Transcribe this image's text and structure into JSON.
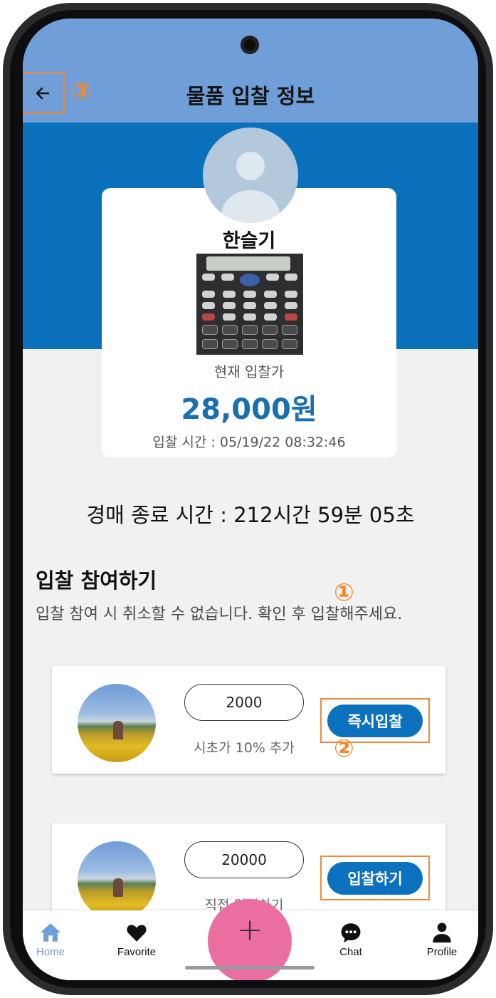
{
  "header": {
    "title": "물품 입찰 정보",
    "back_icon": "arrow-left-icon",
    "annotation_back": "③"
  },
  "seller": {
    "name": "한슬기",
    "avatar_icon": "default-person-avatar"
  },
  "product": {
    "image": "calculator-photo",
    "current_bid_label": "현재 입찰가",
    "current_bid_price": "28,000원",
    "bid_time": "입찰 시간 : 05/19/22 08:32:46"
  },
  "auction": {
    "end_time_text": "경매 종료 시간 : 212시간 59분 05초"
  },
  "participate": {
    "title": "입찰 참여하기",
    "description": "입찰 참여 시 취소할 수 없습니다. 확인 후 입찰해주세요."
  },
  "bid_options": [
    {
      "annotation": "①",
      "amount": "2000",
      "note": "시초가 10% 추가",
      "button_label": "즉시입찰"
    },
    {
      "annotation": "②",
      "amount": "20000",
      "note": "직접 입력하기",
      "button_label": "입찰하기"
    }
  ],
  "bottom_nav": {
    "items": [
      {
        "label": "Home",
        "icon": "home-icon",
        "active": true
      },
      {
        "label": "Favorite",
        "icon": "heart-icon"
      },
      {
        "label": "Chat",
        "icon": "chat-bubble-icon"
      },
      {
        "label": "Profile",
        "icon": "person-icon"
      }
    ],
    "fab_symbol": "+"
  },
  "colors": {
    "appbar": "#6f9ed8",
    "band": "#0a70bc",
    "primary_button": "#0d72bd",
    "price": "#1a6fae",
    "annotation": "#f08c2d",
    "fab": "#ea6fa0"
  }
}
